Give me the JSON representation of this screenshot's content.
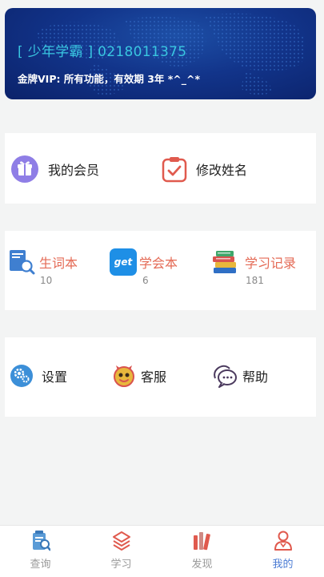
{
  "banner": {
    "user_line": "[ 少年学霸 ] 0218011375",
    "vip_line": "金牌VIP: 所有功能，有效期 3年 *^_^*"
  },
  "menu1": [
    {
      "label": "我的会员",
      "icon": "membership-gift-icon"
    },
    {
      "label": "修改姓名",
      "icon": "edit-name-clipboard-icon"
    }
  ],
  "stats": [
    {
      "label": "生词本",
      "count": "10",
      "icon": "wordbook-icon"
    },
    {
      "label": "学会本",
      "count": "6",
      "icon": "get-learned-icon",
      "icon_text": "get"
    },
    {
      "label": "学习记录",
      "count": "181",
      "icon": "books-record-icon"
    }
  ],
  "menu3": [
    {
      "label": "设置",
      "icon": "settings-gear-icon"
    },
    {
      "label": "客服",
      "icon": "customer-service-icon"
    },
    {
      "label": "帮助",
      "icon": "help-chat-icon"
    }
  ],
  "tabs": [
    {
      "label": "查询",
      "icon": "search-book-icon",
      "active": false
    },
    {
      "label": "学习",
      "icon": "layers-icon",
      "active": false
    },
    {
      "label": "发现",
      "icon": "discover-books-icon",
      "active": false
    },
    {
      "label": "我的",
      "icon": "user-profile-icon",
      "active": true
    }
  ],
  "colors": {
    "accent": "#4a7bd4",
    "stat_label": "#e46a55",
    "banner_text": "#39c6e0"
  }
}
